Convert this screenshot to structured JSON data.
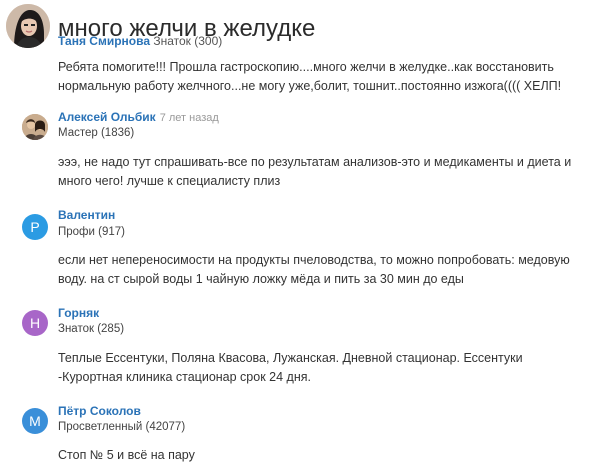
{
  "question": {
    "title": "много желчи в желудке",
    "author_name": "Таня Смирнова",
    "author_rank": "Знаток (300)",
    "body": "Ребята помогите!!! Прошла гастроскопию....много желчи в желудке..как восстановить нормальную работу желчного...не могу уже,болит, тошнит..постоянно изжога(((( ХЕЛП!"
  },
  "answers": [
    {
      "name": "Алексей Ольбик",
      "time": "7 лет назад",
      "rank": "Мастер (1836)",
      "avatar_letter": "",
      "text": "эээ, не надо тут спрашивать-все по результатам анализов-это и медикаменты и диета и много чего! лучше к специалисту плиз"
    },
    {
      "name": "Валентин",
      "time": "",
      "rank": "Профи (917)",
      "avatar_letter": "P",
      "avatar_color": "#2b9be3",
      "text": "если нет непереносимости на продукты пчеловодства, то можно попробовать: медовую воду. на ст сырой воды 1 чайную ложку мёда и пить за 30 мин до еды"
    },
    {
      "name": "Горняк",
      "time": "",
      "rank": "Знаток (285)",
      "avatar_letter": "Н",
      "avatar_color": "#a866c8",
      "text": "Теплые Ессентуки, Поляна Квасова, Лужанская. Дневной стационар. Ессентуки -Курортная клиника стационар срок 24 дня."
    },
    {
      "name": "Пётр Соколов",
      "time": "",
      "rank": "Просветленный (42077)",
      "avatar_letter": "М",
      "avatar_color": "#3a8fd9",
      "text": "Стоп № 5 и всё на пару"
    }
  ]
}
